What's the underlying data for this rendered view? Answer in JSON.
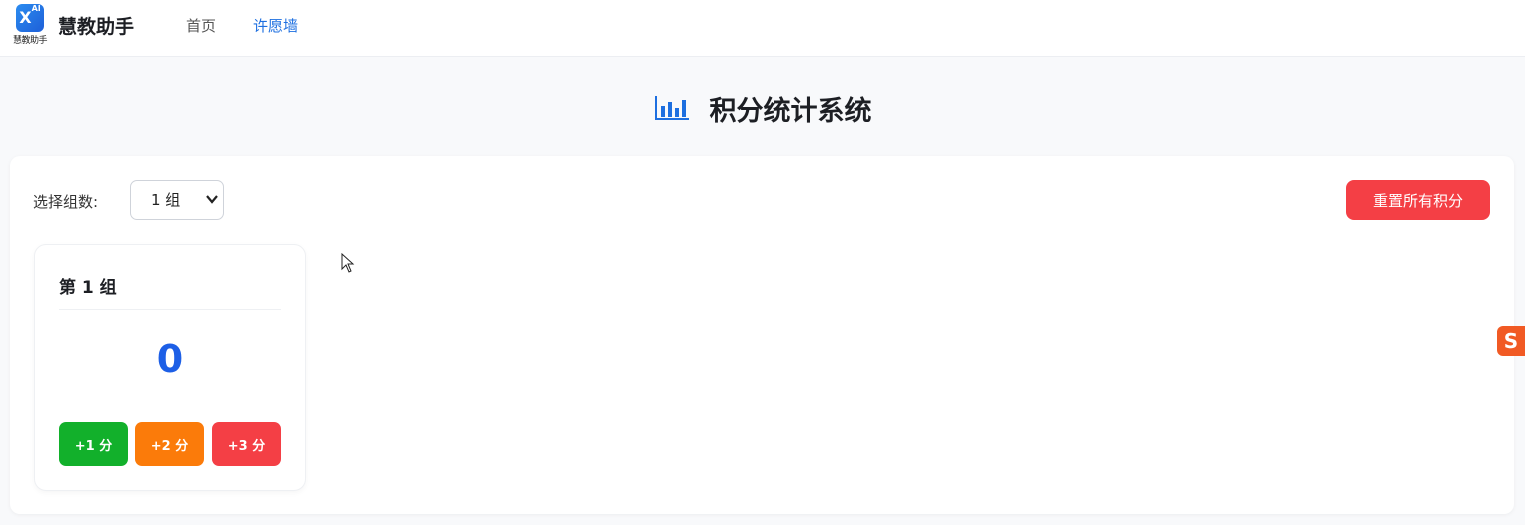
{
  "header": {
    "logo_badge": "X",
    "logo_badge_sup": "AI",
    "logo_caption": "慧教助手",
    "brand": "慧教助手",
    "nav": [
      {
        "label": "首页"
      },
      {
        "label": "许愿墙"
      }
    ]
  },
  "page": {
    "title": "积分统计系统"
  },
  "controls": {
    "group_label": "选择组数:",
    "group_selected": "1 组",
    "reset_label": "重置所有积分"
  },
  "groups": [
    {
      "name": "第 1 组",
      "score": "0",
      "buttons": [
        "+1 分",
        "+2 分",
        "+3 分"
      ]
    }
  ],
  "ime": {
    "glyph": "S"
  },
  "colors": {
    "accent": "#1d6fe0",
    "score": "#1d5fe6",
    "danger": "#f43f45",
    "green": "#12b02b",
    "orange": "#fb7b0a"
  }
}
